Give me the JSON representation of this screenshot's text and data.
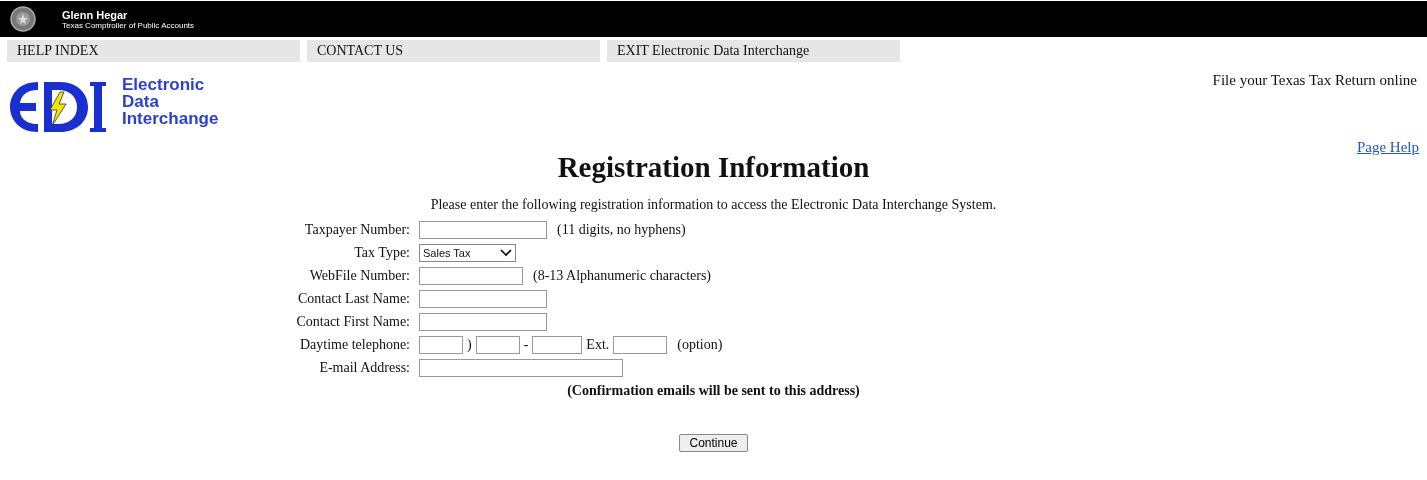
{
  "header": {
    "name": "Glenn Hegar",
    "subtitle": "Texas Comptroller of Public Accounts"
  },
  "nav": [
    {
      "label": "HELP INDEX"
    },
    {
      "label": "CONTACT US"
    },
    {
      "label": "EXIT Electronic Data Interchange"
    }
  ],
  "logo": {
    "lines": [
      "Electronic",
      "Data",
      "Interchange"
    ]
  },
  "promo": "File your Texas Tax Return online",
  "page_help": "Page Help",
  "title": "Registration Information",
  "intro": "Please enter the following registration information to access the Electronic Data Interchange System.",
  "fields": [
    {
      "kind": "number",
      "label": "Taxpayer Number:",
      "hint": "(11 digits, no hyphens)"
    },
    {
      "kind": "select",
      "label": "Tax Type:",
      "value": "Sales Tax"
    },
    {
      "kind": "code",
      "label": "WebFile Number:",
      "hint": "(8-13 Alphanumeric characters)"
    },
    {
      "kind": "text",
      "label": "Contact Last Name:"
    },
    {
      "kind": "text",
      "label": "Contact First Name:"
    },
    {
      "kind": "phone",
      "label": "Daytime telephone:",
      "separators": [
        ")",
        "-",
        "Ext."
      ],
      "hint": "(option)"
    },
    {
      "kind": "email",
      "label": "E-mail Address:"
    }
  ],
  "note": "(Confirmation emails will be sent to this address)",
  "submit": "Continue"
}
